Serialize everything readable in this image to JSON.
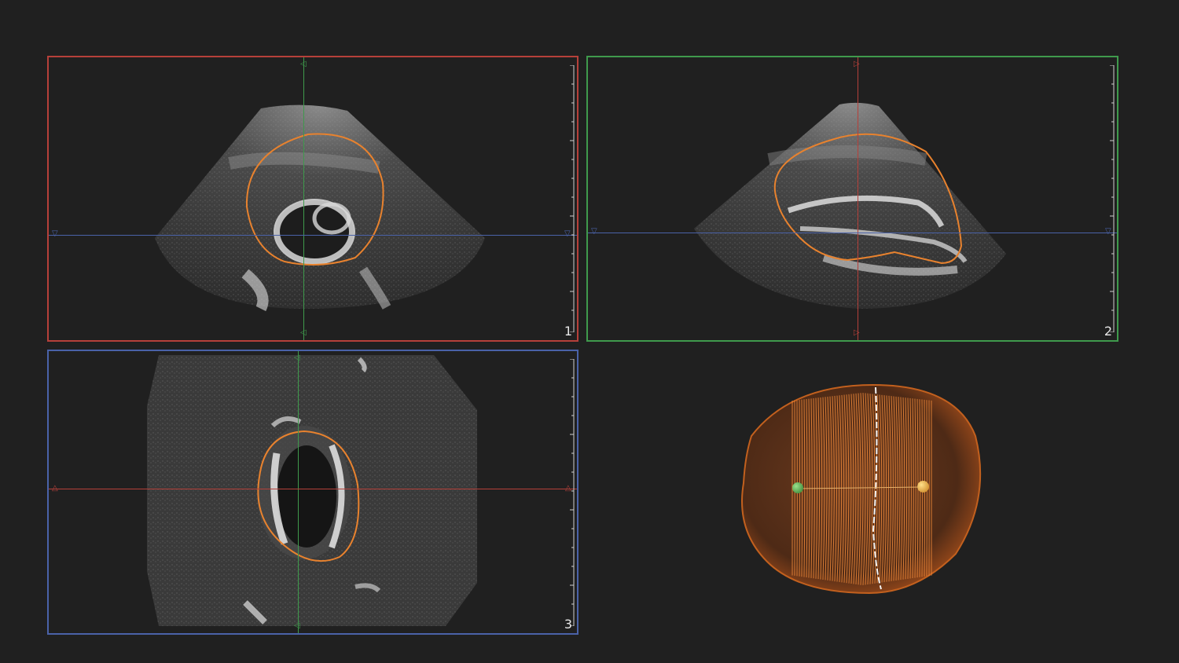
{
  "viewports": [
    {
      "id": "plane-1",
      "number": "1",
      "border_color": "#b6403a"
    },
    {
      "id": "plane-2",
      "number": "2",
      "border_color": "#3f9a4c"
    },
    {
      "id": "plane-3",
      "number": "3",
      "border_color": "#4a62a8"
    }
  ],
  "colors": {
    "background": "#202020",
    "contour": "#e8822e",
    "crosshair_green": "#3f9a4c",
    "crosshair_blue": "#4a62a8",
    "crosshair_red": "#b6403a",
    "landmark_green": "#3fa040",
    "landmark_orange": "#e9a22a"
  },
  "icons": {
    "marker": "triangle-marker-icon",
    "landmark": "sphere-landmark-icon"
  }
}
